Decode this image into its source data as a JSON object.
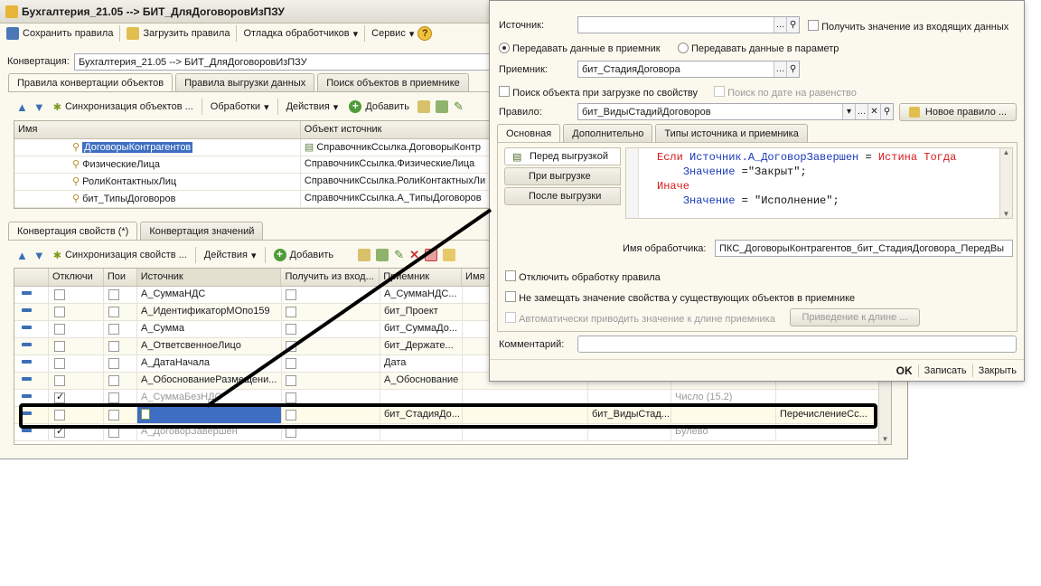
{
  "main_window": {
    "title": "Бухгалтерия_21.05 --> БИТ_ДляДоговоровИзПЗУ",
    "toolbar": {
      "save_rules": "Сохранить правила",
      "load_rules": "Загрузить правила",
      "debug_handlers": "Отладка обработчиков",
      "service": "Сервис"
    },
    "conversion_label": "Конвертация:",
    "conversion_value": "Бухгалтерия_21.05 --> БИТ_ДляДоговоровИзПЗУ",
    "tabs": [
      "Правила конвертации объектов",
      "Правила выгрузки данных",
      "Поиск объектов в приемнике"
    ],
    "obj_toolbar": {
      "sync": "Синхронизация объектов ...",
      "processing": "Обработки",
      "actions": "Действия",
      "add": "Добавить"
    },
    "obj_table": {
      "headers": [
        "Имя",
        "Объект источник"
      ],
      "rows": [
        {
          "name": "ДоговорыКонтрагентов",
          "source": "СправочникСсылка.ДоговорыКонтр"
        },
        {
          "name": "ФизическиеЛица",
          "source": "СправочникСсылка.ФизическиеЛица"
        },
        {
          "name": "РолиКонтактныхЛиц",
          "source": "СправочникСсылка.РолиКонтактныхЛи"
        },
        {
          "name": "бит_ТипыДоговоров",
          "source": "СправочникСсылка.А_ТипыДоговоров"
        }
      ]
    },
    "prop_tabs": [
      "Конвертация свойств (*)",
      "Конвертация значений"
    ],
    "prop_toolbar": {
      "sync": "Синхронизация свойств ...",
      "actions": "Действия",
      "add": "Добавить"
    },
    "prop_table": {
      "headers": [
        "Отключи",
        "Пои",
        "Источник",
        "Получить из вход...",
        "Приемник",
        "Имя"
      ],
      "rows": [
        {
          "disabled": false,
          "search": false,
          "source": "А_СуммаНДС",
          "get_in": false,
          "dest": "А_СуммаНДС...",
          "rule": "",
          "dest_type": "",
          "extra": "",
          "greyed": false
        },
        {
          "disabled": false,
          "search": false,
          "source": "А_ИдентификаторМОпо159",
          "get_in": false,
          "dest": "бит_Проект",
          "rule": "",
          "dest_type": "",
          "extra": "",
          "greyed": false
        },
        {
          "disabled": false,
          "search": false,
          "source": "А_Сумма",
          "get_in": false,
          "dest": "бит_СуммаДо...",
          "rule": "",
          "dest_type": "",
          "extra": "",
          "greyed": false
        },
        {
          "disabled": false,
          "search": false,
          "source": "А_ОтветсвенноеЛицо",
          "get_in": false,
          "dest": "бит_Держате...",
          "rule": "",
          "dest_type": "",
          "extra": "",
          "greyed": false
        },
        {
          "disabled": false,
          "search": false,
          "source": "А_ДатаНачала",
          "get_in": false,
          "dest": "Дата",
          "rule": "",
          "dest_type": "",
          "extra": "",
          "greyed": false
        },
        {
          "disabled": false,
          "search": false,
          "source": "А_ОбоснованиеРазмещени...",
          "get_in": false,
          "dest": "А_Обоснование",
          "rule": "",
          "dest_type": "",
          "extra": "",
          "greyed": false
        },
        {
          "disabled": true,
          "search": false,
          "source": "А_СуммаБезНДС",
          "get_in": false,
          "dest": "",
          "rule": "",
          "dest_type": "Число (15.2)",
          "extra": "",
          "greyed": true
        },
        {
          "disabled": false,
          "search": false,
          "source": "",
          "get_in": false,
          "dest": "бит_СтадияДо...",
          "rule": "бит_ВидыСтад...",
          "dest_type": "",
          "extra": "ПеречислениеСс...",
          "greyed": false,
          "selected": true
        },
        {
          "disabled": true,
          "search": false,
          "source": "А_ДоговорЗавершен",
          "get_in": false,
          "dest": "",
          "rule": "",
          "dest_type": "Булево",
          "extra": "",
          "greyed": true
        }
      ]
    }
  },
  "dialog": {
    "source_label": "Источник:",
    "source_value": "",
    "get_from_incoming": "Получить значение из входящих данных",
    "radio_dest": "Передавать данные в приемник",
    "radio_param": "Передавать данные в параметр",
    "dest_label": "Приемник:",
    "dest_value": "бит_СтадияДоговора",
    "search_by_prop": "Поиск объекта при загрузке по свойству",
    "search_by_date": "Поиск по дате на равенство",
    "rule_label": "Правило:",
    "rule_value": "бит_ВидыСтадийДоговоров",
    "new_rule_button": "Новое правило ...",
    "tabs": [
      "Основная",
      "Дополнительно",
      "Типы источника и приемника"
    ],
    "side_tabs": [
      "Перед выгрузкой",
      "При выгрузке",
      "После выгрузки"
    ],
    "code_lines": [
      {
        "indent": "",
        "parts": [
          [
            "kw",
            "Если "
          ],
          [
            "id",
            "Источник.А_ДоговорЗавершен"
          ],
          [
            "op",
            " = "
          ],
          [
            "kw",
            "Истина Тогда"
          ]
        ]
      },
      {
        "indent": "    ",
        "parts": [
          [
            "id",
            "Значение"
          ],
          [
            "op",
            " ="
          ],
          [
            "str",
            "\"Закрыт\""
          ],
          [
            "op",
            ";"
          ]
        ]
      },
      {
        "indent": "",
        "parts": [
          [
            "kw",
            "Иначе"
          ]
        ]
      },
      {
        "indent": "    ",
        "parts": [
          [
            "id",
            "Значение"
          ],
          [
            "op",
            " = "
          ],
          [
            "str",
            "\"Исполнение\""
          ],
          [
            "op",
            ";"
          ]
        ]
      }
    ],
    "handler_label": "Имя обработчика:",
    "handler_value": "ПКС_ДоговорыКонтрагентов_бит_СтадияДоговора_ПередВы",
    "disable_processing": "Отключить обработку правила",
    "no_replace": "Не замещать значение свойства у существующих объектов в приемнике",
    "auto_length": "Автоматически приводить значение к длине приемника",
    "cast_length_button": "Приведение к длине ...",
    "comment_label": "Комментарий:",
    "comment_value": "",
    "ok": "OK",
    "write": "Записать",
    "close": "Закрыть"
  },
  "colors": {
    "selection": "#3d6ec1",
    "annotation": "#000000",
    "keyword": "#d61a1a",
    "identifier": "#1a39b8"
  }
}
